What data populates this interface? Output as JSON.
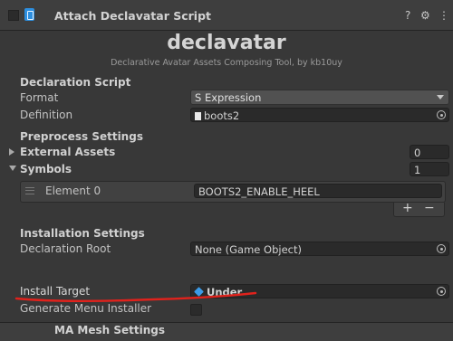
{
  "header": {
    "title": "Attach Declavatar Script",
    "help_icon": "?",
    "settings_icon": "⚙",
    "more_icon": "⋮"
  },
  "banner": {
    "title": "declavatar",
    "subtitle": "Declarative Avatar Assets Composing Tool, by kb10uy"
  },
  "declaration": {
    "section": "Declaration Script",
    "format_label": "Format",
    "format_value": "S Expression",
    "definition_label": "Definition",
    "definition_value": "boots2"
  },
  "preprocess": {
    "section": "Preprocess Settings",
    "external_label": "External Assets",
    "external_count": "0",
    "symbols_label": "Symbols",
    "symbols_count": "1",
    "elements": [
      {
        "label": "Element 0",
        "value": "BOOTS2_ENABLE_HEEL"
      }
    ],
    "add_label": "+",
    "remove_label": "−"
  },
  "installation": {
    "section": "Installation Settings",
    "root_label": "Declaration Root",
    "root_value": "None (Game Object)",
    "target_label": "Install Target",
    "target_value": "Under",
    "menu_label": "Generate Menu Installer"
  },
  "next_component": {
    "title": "MA Mesh Settings"
  },
  "colors": {
    "annotation": "#e0221c",
    "accent": "#2d8fe0"
  }
}
